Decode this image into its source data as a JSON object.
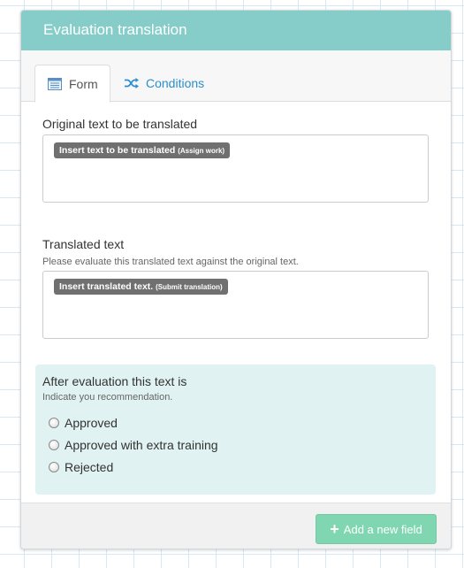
{
  "panel": {
    "title": "Evaluation translation"
  },
  "tabs": [
    {
      "label": "Form",
      "icon": "form-list-icon",
      "active": true
    },
    {
      "label": "Conditions",
      "icon": "shuffle-icon",
      "active": false
    }
  ],
  "fields": {
    "original": {
      "label": "Original text to be translated",
      "token_main": "Insert text to be translated",
      "token_sub": "(Assign work)"
    },
    "translated": {
      "label": "Translated text",
      "help": "Please evaluate this translated text against the original text.",
      "token_main": "Insert translated text.",
      "token_sub": "(Submit translation)"
    },
    "evaluation": {
      "label": "After evaluation this text is",
      "help": "Indicate you recommendation.",
      "options": [
        "Approved",
        "Approved with extra training",
        "Rejected"
      ]
    }
  },
  "footer": {
    "add_label": "Add a new field",
    "add_icon": "plus-icon"
  },
  "colors": {
    "header": "#86cdc9",
    "accent_link": "#2a8fd0",
    "eval_bg": "#e0f2f1",
    "add_button": "#7fd6b1"
  }
}
